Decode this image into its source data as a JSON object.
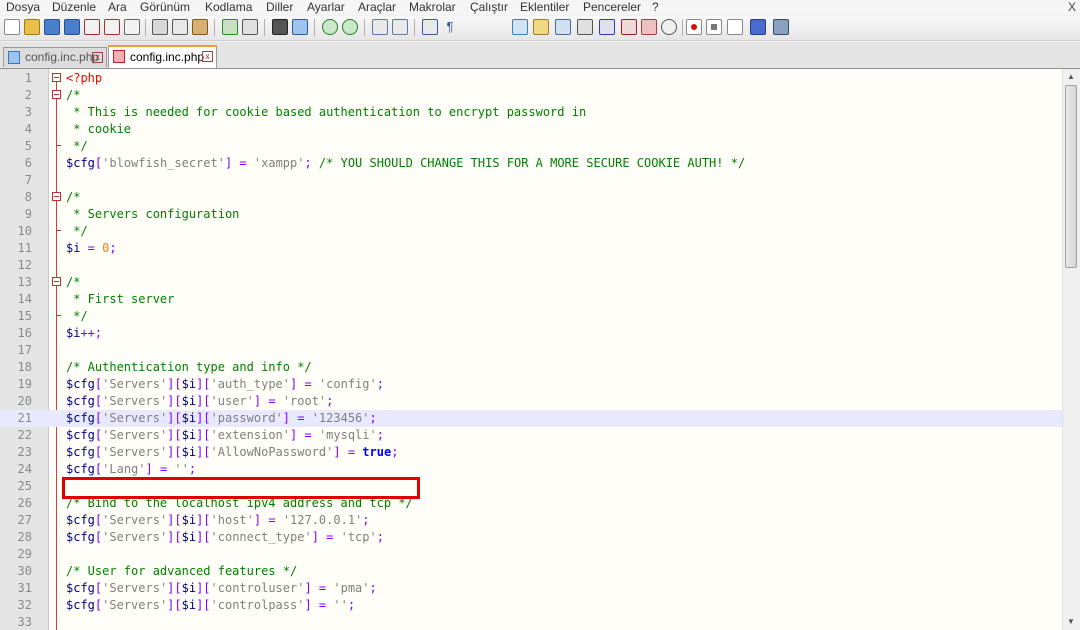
{
  "menu": {
    "items": [
      "Dosya",
      "Düzenle",
      "Ara",
      "Görünüm",
      "Kodlama",
      "Diller",
      "Ayarlar",
      "Araçlar",
      "Makrolar",
      "Çalıştır",
      "Eklentiler",
      "Pencereler",
      "?"
    ],
    "close": "X"
  },
  "tabs": [
    {
      "label": "config.inc.php",
      "active": false
    },
    {
      "label": "config.inc.php",
      "active": true
    }
  ],
  "tab_close_glyph": "x",
  "colors": {
    "php_tag": "#ff0000",
    "comment": "#008000",
    "variable": "#000080",
    "string": "#808080",
    "number": "#ff8000",
    "operator": "#8000ff",
    "keyword": "#0000ff",
    "highlight_box": "#e00000"
  },
  "editor": {
    "current_line": 21,
    "highlighted_line": 21,
    "lines": [
      {
        "n": "1",
        "fold": "box",
        "tokens": [
          [
            "php",
            "<?php"
          ]
        ]
      },
      {
        "n": "2",
        "fold": "box",
        "tokens": [
          [
            "cmt",
            "/*"
          ]
        ]
      },
      {
        "n": "3",
        "fold": "",
        "tokens": [
          [
            "cmt",
            " * This is needed for cookie based authentication to encrypt password in"
          ]
        ]
      },
      {
        "n": "4",
        "fold": "",
        "tokens": [
          [
            "cmt",
            " * cookie"
          ]
        ]
      },
      {
        "n": "5",
        "fold": "end",
        "tokens": [
          [
            "cmt",
            " */"
          ]
        ]
      },
      {
        "n": "6",
        "fold": "",
        "tokens": [
          [
            "var",
            "$cfg"
          ],
          [
            "op",
            "["
          ],
          [
            "str",
            "'blowfish_secret'"
          ],
          [
            "op",
            "]"
          ],
          [
            "op",
            " = "
          ],
          [
            "str",
            "'xampp'"
          ],
          [
            "op",
            "; "
          ],
          [
            "cmt",
            "/* YOU SHOULD CHANGE THIS FOR A MORE SECURE COOKIE AUTH! */"
          ]
        ]
      },
      {
        "n": "7",
        "fold": "",
        "tokens": []
      },
      {
        "n": "8",
        "fold": "box",
        "tokens": [
          [
            "cmt",
            "/*"
          ]
        ]
      },
      {
        "n": "9",
        "fold": "",
        "tokens": [
          [
            "cmt",
            " * Servers configuration"
          ]
        ]
      },
      {
        "n": "10",
        "fold": "end",
        "tokens": [
          [
            "cmt",
            " */"
          ]
        ]
      },
      {
        "n": "11",
        "fold": "",
        "tokens": [
          [
            "var",
            "$i"
          ],
          [
            "op",
            " = "
          ],
          [
            "num",
            "0"
          ],
          [
            "op",
            ";"
          ]
        ]
      },
      {
        "n": "12",
        "fold": "",
        "tokens": []
      },
      {
        "n": "13",
        "fold": "box",
        "tokens": [
          [
            "cmt",
            "/*"
          ]
        ]
      },
      {
        "n": "14",
        "fold": "",
        "tokens": [
          [
            "cmt",
            " * First server"
          ]
        ]
      },
      {
        "n": "15",
        "fold": "end",
        "tokens": [
          [
            "cmt",
            " */"
          ]
        ]
      },
      {
        "n": "16",
        "fold": "",
        "tokens": [
          [
            "var",
            "$i"
          ],
          [
            "op",
            "++;"
          ]
        ]
      },
      {
        "n": "17",
        "fold": "",
        "tokens": []
      },
      {
        "n": "18",
        "fold": "",
        "tokens": [
          [
            "cmt",
            "/* Authentication type and info */"
          ]
        ]
      },
      {
        "n": "19",
        "fold": "",
        "tokens": [
          [
            "var",
            "$cfg"
          ],
          [
            "op",
            "["
          ],
          [
            "str",
            "'Servers'"
          ],
          [
            "op",
            "]["
          ],
          [
            "var",
            "$i"
          ],
          [
            "op",
            "]["
          ],
          [
            "str",
            "'auth_type'"
          ],
          [
            "op",
            "]"
          ],
          [
            "op",
            " = "
          ],
          [
            "str",
            "'config'"
          ],
          [
            "op",
            ";"
          ]
        ]
      },
      {
        "n": "20",
        "fold": "",
        "tokens": [
          [
            "var",
            "$cfg"
          ],
          [
            "op",
            "["
          ],
          [
            "str",
            "'Servers'"
          ],
          [
            "op",
            "]["
          ],
          [
            "var",
            "$i"
          ],
          [
            "op",
            "]["
          ],
          [
            "str",
            "'user'"
          ],
          [
            "op",
            "]"
          ],
          [
            "op",
            " = "
          ],
          [
            "str",
            "'root'"
          ],
          [
            "op",
            ";"
          ]
        ]
      },
      {
        "n": "21",
        "fold": "",
        "tokens": [
          [
            "var",
            "$cfg"
          ],
          [
            "op",
            "["
          ],
          [
            "str",
            "'Servers'"
          ],
          [
            "op",
            "]["
          ],
          [
            "var",
            "$i"
          ],
          [
            "op",
            "]["
          ],
          [
            "str",
            "'password'"
          ],
          [
            "op",
            "]"
          ],
          [
            "op",
            " = "
          ],
          [
            "str",
            "'123456'"
          ],
          [
            "op",
            ";"
          ]
        ]
      },
      {
        "n": "22",
        "fold": "",
        "tokens": [
          [
            "var",
            "$cfg"
          ],
          [
            "op",
            "["
          ],
          [
            "str",
            "'Servers'"
          ],
          [
            "op",
            "]["
          ],
          [
            "var",
            "$i"
          ],
          [
            "op",
            "]["
          ],
          [
            "str",
            "'extension'"
          ],
          [
            "op",
            "]"
          ],
          [
            "op",
            " = "
          ],
          [
            "str",
            "'mysqli'"
          ],
          [
            "op",
            ";"
          ]
        ]
      },
      {
        "n": "23",
        "fold": "",
        "tokens": [
          [
            "var",
            "$cfg"
          ],
          [
            "op",
            "["
          ],
          [
            "str",
            "'Servers'"
          ],
          [
            "op",
            "]["
          ],
          [
            "var",
            "$i"
          ],
          [
            "op",
            "]["
          ],
          [
            "str",
            "'AllowNoPassword'"
          ],
          [
            "op",
            "]"
          ],
          [
            "op",
            " = "
          ],
          [
            "kw",
            "true"
          ],
          [
            "op",
            ";"
          ]
        ]
      },
      {
        "n": "24",
        "fold": "",
        "tokens": [
          [
            "var",
            "$cfg"
          ],
          [
            "op",
            "["
          ],
          [
            "str",
            "'Lang'"
          ],
          [
            "op",
            "]"
          ],
          [
            "op",
            " = "
          ],
          [
            "str",
            "''"
          ],
          [
            "op",
            ";"
          ]
        ]
      },
      {
        "n": "25",
        "fold": "",
        "tokens": []
      },
      {
        "n": "26",
        "fold": "",
        "tokens": [
          [
            "cmt",
            "/* Bind to the localhost ipv4 address and tcp */"
          ]
        ]
      },
      {
        "n": "27",
        "fold": "",
        "tokens": [
          [
            "var",
            "$cfg"
          ],
          [
            "op",
            "["
          ],
          [
            "str",
            "'Servers'"
          ],
          [
            "op",
            "]["
          ],
          [
            "var",
            "$i"
          ],
          [
            "op",
            "]["
          ],
          [
            "str",
            "'host'"
          ],
          [
            "op",
            "]"
          ],
          [
            "op",
            " = "
          ],
          [
            "str",
            "'127.0.0.1'"
          ],
          [
            "op",
            ";"
          ]
        ]
      },
      {
        "n": "28",
        "fold": "",
        "tokens": [
          [
            "var",
            "$cfg"
          ],
          [
            "op",
            "["
          ],
          [
            "str",
            "'Servers'"
          ],
          [
            "op",
            "]["
          ],
          [
            "var",
            "$i"
          ],
          [
            "op",
            "]["
          ],
          [
            "str",
            "'connect_type'"
          ],
          [
            "op",
            "]"
          ],
          [
            "op",
            " = "
          ],
          [
            "str",
            "'tcp'"
          ],
          [
            "op",
            ";"
          ]
        ]
      },
      {
        "n": "29",
        "fold": "",
        "tokens": []
      },
      {
        "n": "30",
        "fold": "",
        "tokens": [
          [
            "cmt",
            "/* User for advanced features */"
          ]
        ]
      },
      {
        "n": "31",
        "fold": "",
        "tokens": [
          [
            "var",
            "$cfg"
          ],
          [
            "op",
            "["
          ],
          [
            "str",
            "'Servers'"
          ],
          [
            "op",
            "]["
          ],
          [
            "var",
            "$i"
          ],
          [
            "op",
            "]["
          ],
          [
            "str",
            "'controluser'"
          ],
          [
            "op",
            "]"
          ],
          [
            "op",
            " = "
          ],
          [
            "str",
            "'pma'"
          ],
          [
            "op",
            ";"
          ]
        ]
      },
      {
        "n": "32",
        "fold": "",
        "tokens": [
          [
            "var",
            "$cfg"
          ],
          [
            "op",
            "["
          ],
          [
            "str",
            "'Servers'"
          ],
          [
            "op",
            "]["
          ],
          [
            "var",
            "$i"
          ],
          [
            "op",
            "]["
          ],
          [
            "str",
            "'controlpass'"
          ],
          [
            "op",
            "]"
          ],
          [
            "op",
            " = "
          ],
          [
            "str",
            "''"
          ],
          [
            "op",
            ";"
          ]
        ]
      },
      {
        "n": "33",
        "fold": "",
        "tokens": []
      }
    ]
  }
}
